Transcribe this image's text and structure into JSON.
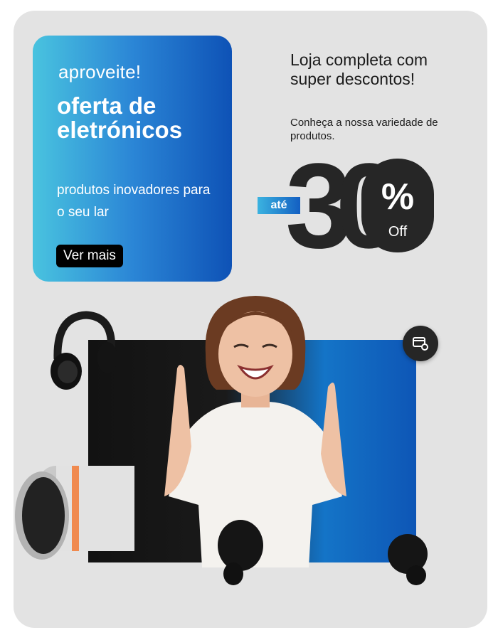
{
  "promo": {
    "kicker": "aproveite!",
    "title": "oferta de eletrónicos",
    "subtitle": "produtos inovadores para o seu lar",
    "button_label": "Ver mais"
  },
  "headline": "Loja completa com super descontos!",
  "subheadline": "Conheça a nossa variedade de produtos.",
  "discount": {
    "prefix": "até",
    "number": "30",
    "percent_sign": "%",
    "suffix": "Off"
  },
  "icons": {
    "chip": "card-settings-icon"
  },
  "colors": {
    "background": "#e3e3e3",
    "gradient_start": "#49c3df",
    "gradient_end": "#0e52b6",
    "dark": "#262626"
  }
}
